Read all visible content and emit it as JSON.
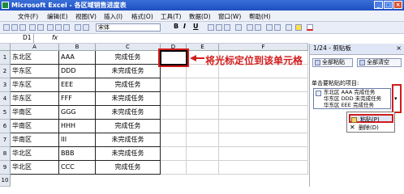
{
  "window": {
    "title": "Microsoft Excel - 各区域销售进度表"
  },
  "menu": [
    "文件(F)",
    "编辑(E)",
    "视图(V)",
    "插入(I)",
    "格式(O)",
    "工具(T)",
    "数据(D)",
    "窗口(W)",
    "帮助(H)"
  ],
  "toolbar": {
    "font_name": "宋体",
    "bold": "B",
    "italic": "I",
    "underline": "U"
  },
  "formula_bar": {
    "name_box": "D1",
    "fx": "fx"
  },
  "sheet": {
    "columns": [
      "A",
      "B",
      "C",
      "D",
      "E",
      "F"
    ],
    "rows": [
      [
        "东北区",
        "AAA",
        "完成任务"
      ],
      [
        "华东区",
        "DDD",
        "未完成任务"
      ],
      [
        "华东区",
        "EEE",
        "完成任务"
      ],
      [
        "华东区",
        "FFF",
        "未完成任务"
      ],
      [
        "华南区",
        "GGG",
        "未完成任务"
      ],
      [
        "华南区",
        "HHH",
        "完成任务"
      ],
      [
        "华南区",
        "III",
        "未完成任务"
      ],
      [
        "华北区",
        "BBB",
        "未完成任务"
      ],
      [
        "华北区",
        "CCC",
        "完成任务"
      ]
    ],
    "row_numbers": [
      "1",
      "2",
      "3",
      "4",
      "5",
      "6",
      "7",
      "8",
      "9",
      "10"
    ]
  },
  "annotation": {
    "text": "将光标定位到该单元格",
    "color": "#d21c1c"
  },
  "clipboard": {
    "header": "1/24 - 剪贴板",
    "paste_all": "全部粘贴",
    "clear_all": "全部清空",
    "prompt": "单击要粘贴的项目:",
    "item_lines": [
      "东北区 AAA 完成任务",
      "华东区 DDD 未完成任务",
      "华东区 EEE 完成任务"
    ],
    "menu_paste": "粘贴(P)",
    "menu_delete": "删除(D)"
  }
}
